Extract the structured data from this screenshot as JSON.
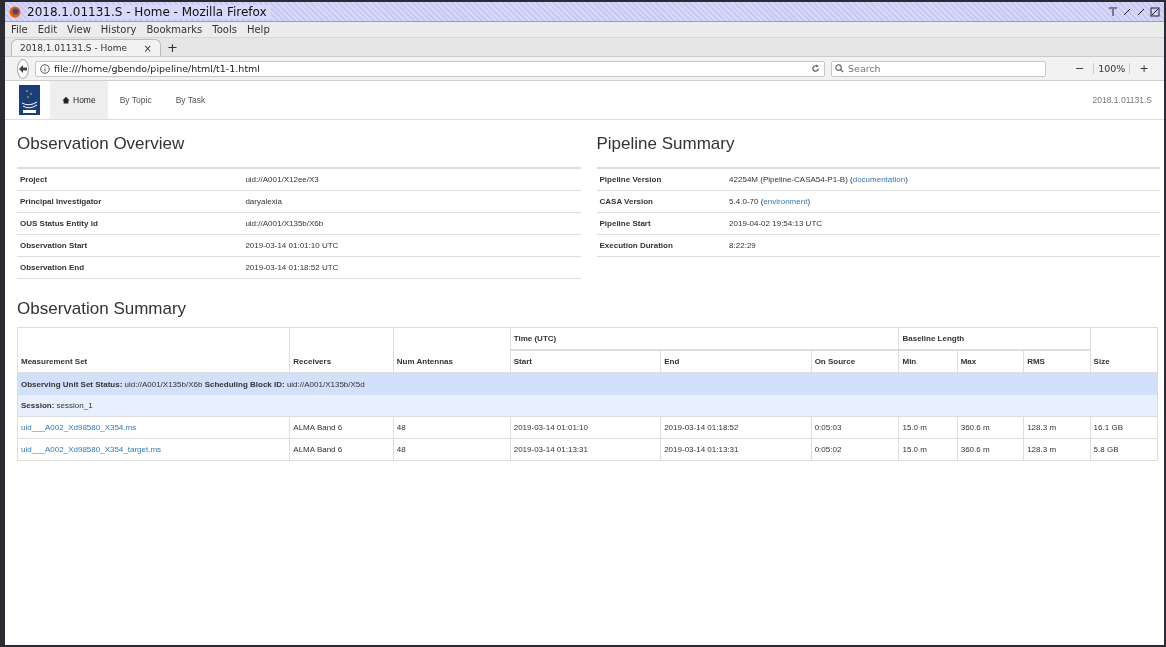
{
  "window": {
    "title": "2018.1.01131.S - Home - Mozilla Firefox"
  },
  "menu": [
    "File",
    "Edit",
    "View",
    "History",
    "Bookmarks",
    "Tools",
    "Help"
  ],
  "tabs": [
    {
      "label": "2018.1.01131.S - Home",
      "close": "×",
      "selected": true
    }
  ],
  "new_tab": "+",
  "toolbar": {
    "url": "file:///home/gbendo/pipeline/html/t1-1.html",
    "search_placeholder": "Search",
    "zoom_out": "−",
    "zoom": "100%",
    "zoom_in": "+"
  },
  "nav": {
    "items": [
      {
        "label": "Home",
        "selected": true
      },
      {
        "label": "By Topic",
        "selected": false
      },
      {
        "label": "By Task",
        "selected": false
      }
    ],
    "project": "2018.1.01131.S"
  },
  "overview": {
    "title": "Observation Overview",
    "rows": [
      {
        "label": "Project",
        "value": "uid://A001/X12ee/X3"
      },
      {
        "label": "Principal Investigator",
        "value": "daryalexia"
      },
      {
        "label": "OUS Status Entity id",
        "value": "uid://A001/X135b/X6b"
      },
      {
        "label": "Observation Start",
        "value": "2019-03-14 01:01:10 UTC"
      },
      {
        "label": "Observation End",
        "value": "2019-03-14 01:18:52 UTC"
      }
    ]
  },
  "pipeline": {
    "title": "Pipeline Summary",
    "rows": [
      {
        "label": "Pipeline Version",
        "value": "42254M (Pipeline-CASA54-P1-B) (",
        "link": "documentation",
        "after": ")"
      },
      {
        "label": "CASA Version",
        "value": "5.4.0-70 (",
        "link": "environment",
        "after": ")"
      },
      {
        "label": "Pipeline Start",
        "value": "2019-04-02 19:54:13 UTC"
      },
      {
        "label": "Execution Duration",
        "value": "8:22:29"
      }
    ]
  },
  "summary": {
    "title": "Observation Summary",
    "header_rows": [
      [
        {
          "text": "Measurement Set",
          "rowspan": 2
        },
        {
          "text": "Receivers",
          "rowspan": 2
        },
        {
          "text": "Num Antennas",
          "rowspan": 2
        },
        {
          "text": "Time (UTC)",
          "colspan": 3
        },
        {
          "text": "Baseline Length",
          "colspan": 3
        },
        {
          "text": "Size",
          "rowspan": 2
        }
      ],
      [
        {
          "text": "Start"
        },
        {
          "text": "End"
        },
        {
          "text": "On Source"
        },
        {
          "text": "Min"
        },
        {
          "text": "Max"
        },
        {
          "text": "RMS"
        }
      ]
    ],
    "ous_row": "**Observing Unit Set Status:** uid://A001/X135b/X6b **Scheduling Block ID:** uid://A001/X135b/X5d",
    "session_row": "**Session:** session_1",
    "rows": [
      [
        "uid___A002_Xd98580_X354.ms",
        "ALMA Band 6",
        "48",
        "2019-03-14 01:01:10",
        "2019-03-14 01:18:52",
        "0:05:03",
        "15.0 m",
        "360.6 m",
        "128.3 m",
        "16.1 GB"
      ],
      [
        "uid___A002_Xd98580_X354_target.ms",
        "ALMA Band 6",
        "48",
        "2019-03-14 01:13:31",
        "2019-03-14 01:13:31",
        "0:05:02",
        "15.0 m",
        "360.6 m",
        "128.3 m",
        "5.8 GB"
      ]
    ]
  }
}
